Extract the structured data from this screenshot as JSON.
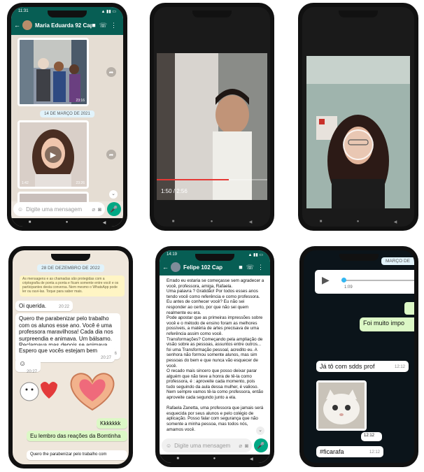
{
  "phone1": {
    "status_time": "11:31",
    "contact_name": "Maria Eduarda 92 Cap",
    "date_chip": "14 DE MARÇO DE 2021",
    "video_duration": "1:42",
    "time_a": "23:16",
    "time_b": "23:26",
    "input_placeholder": "Digite uma mensagem"
  },
  "phone2": {
    "time_progress": "1:50 / 2:56",
    "progress_fraction": 0.65
  },
  "phone3": {},
  "phone4": {
    "date_chip": "28 DE DEZEMBRO DE 2022",
    "encryption_notice": "As mensagens e as chamadas são protegidas com a criptografia de ponta a ponta e ficam somente entre você e os participantes desta conversa. Nem mesmo o WhatsApp pode ler ou ouvi-las. Toque para saber mais.",
    "msg1": "Oi querida.",
    "msg1_time": "20:22",
    "msg2": "Quero the parabenizar pelo trabalho com os alunos esse ano. Você é uma professora maravilhosa! Cada dia nos surpreendia e animava. Um bálsamo. Reclamava mas depois se animava.",
    "msg2_time": "20:26",
    "msg3": "Espero que vocês estejam bem",
    "msg3_time": "20:27",
    "small_time": "20:27",
    "msg4": "Kkkkkkk",
    "msg4_time": "20:28",
    "msg5": "Eu lembro das reações da Bomtinha",
    "msg6": "Quero the parabenizar pelo trabalho com"
  },
  "phone5": {
    "status_time": "14:19",
    "contact_name": "Felipe 102 Cap",
    "letter": "Errado eu estaria se começasse sem agradecer a você, professora, amiga, Rafaela.\nUma palavra ? Gratidão! Por todos esses anos tendo você como referência e como professora.\nEu antes de conhecer você? Eu não sei responder ao certo, por que não sei quem realmente eu era.\nPode apostar que as primeiras impressões sobre você e o método de ensino foram as melhores possíveis, a matéria de artes precisava de uma referência assim como você.\nTransformações? Começando pela ampliação de visão sobre as pessoas, assuntos entre outros... foi uma Transformação pessoal, acredito eu. A senhora não formou somente alunos, mas sim pessoas do bem e que nunca vão esquecer de você.\nO recado mais sincero que posso deixar parar alguém que não teve a honra de tê-la como professora, é : aproveite cada momento, pois tudo seguindo da aula dessa mulher, é valioso. Nem sempre vamos tê-la como professora, então aproveite cada segundo junto a ela.\n\nRafaela Zanetta, uma professora que jamais será esquecida por seus alunos e pelo colégio de aplicação. Posso falar com segurança que não somente a minha pessoa, mas todos nós, amamos você.",
    "input_placeholder": "Digite uma mensagem"
  },
  "phone6": {
    "date_chip": "MARÇO DE",
    "voice_duration": "1:09",
    "msg1": "Foi muito impo",
    "msg2": "Já tô com sdds prof",
    "msg2_time": "12:12",
    "img_time": "12:12",
    "msg3": "#ficarafa",
    "msg3_time": "12:12"
  },
  "colors": {
    "whatsapp_header": "#075e54",
    "bubble_out": "#dcf8c6",
    "accent": "#00a884",
    "video_progress": "#e53935"
  }
}
